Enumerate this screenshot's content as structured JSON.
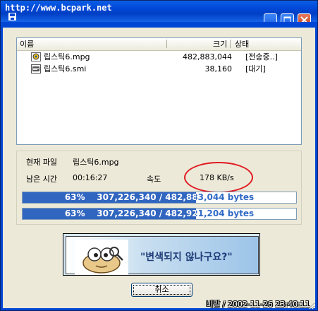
{
  "window": {
    "title": "http://www.bcpark.net",
    "buttons": [
      "minimize",
      "maximize",
      "close"
    ]
  },
  "list": {
    "columns": {
      "name": "이름",
      "size": "크기",
      "status": "상태"
    },
    "rows": [
      {
        "icon": "video-file-icon",
        "name": "립스틱6.mpg",
        "size": "482,883,044",
        "status": "[전송중..]"
      },
      {
        "icon": "subtitle-file-icon",
        "name": "립스틱6.smi",
        "size": "38,160",
        "status": "[대기]"
      }
    ]
  },
  "transfer": {
    "current_file_label": "현재 파일",
    "current_file": "립스틱6.mpg",
    "remaining_label": "남은 시간",
    "remaining": "00:16:27",
    "speed_label": "속도",
    "speed": "178 KB/s"
  },
  "progress": [
    {
      "percent_label": "63%",
      "bytes": "307,226,340 / 482,883,044 bytes",
      "fraction": 0.635
    },
    {
      "percent_label": "63%",
      "bytes": "307,226,340 / 482,921,204 bytes",
      "fraction": 0.635
    }
  ],
  "ad": {
    "text": "\"변색되지 않나구요?\""
  },
  "buttons": {
    "cancel": "취소"
  },
  "stamp": "비말 / 2002-11-26 23:40:11",
  "colors": {
    "progress_fill": "#3166c0",
    "titlebar": "#0046d5",
    "annotation": "#e11a22"
  }
}
